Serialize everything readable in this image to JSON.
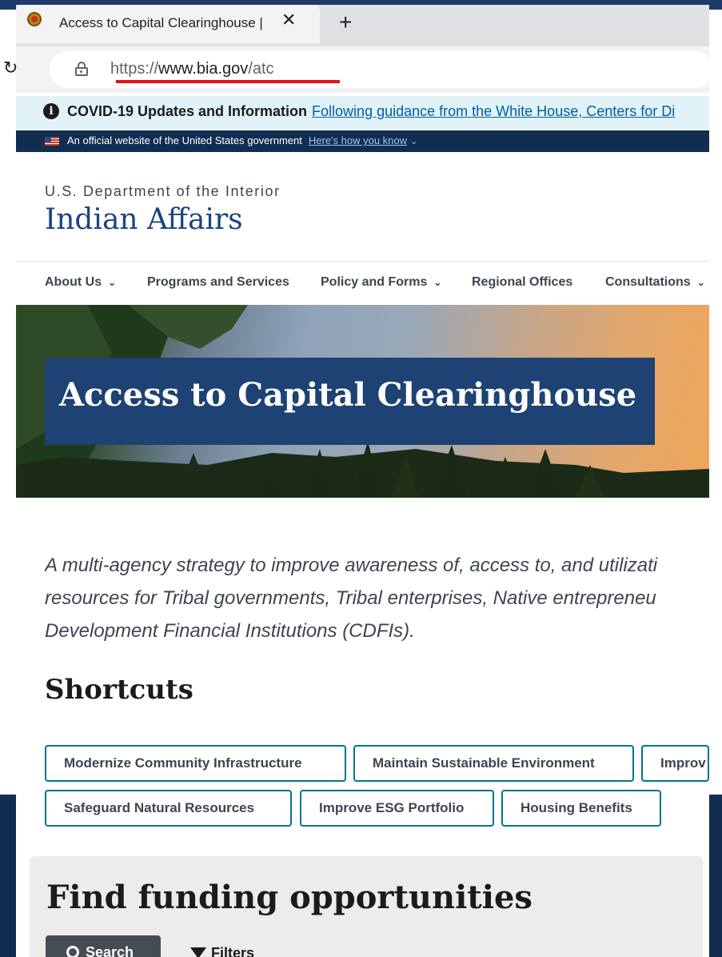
{
  "browser": {
    "tab_title": "Access to Capital Clearinghouse |",
    "url_scheme": "https://",
    "url_host": "www.bia.gov",
    "url_path": "/atc"
  },
  "covid_banner": {
    "heading": "COVID-19 Updates and Information",
    "link": "Following guidance from the White House, Centers for Di"
  },
  "gov_banner": {
    "text": "An official website of the United States government",
    "link": "Here's how you know"
  },
  "site": {
    "agency": "U.S. Department of the Interior",
    "title": "Indian Affairs"
  },
  "nav": [
    {
      "label": "About Us",
      "has_dropdown": true
    },
    {
      "label": "Programs and Services",
      "has_dropdown": false
    },
    {
      "label": "Policy and Forms",
      "has_dropdown": true
    },
    {
      "label": "Regional Offices",
      "has_dropdown": false
    },
    {
      "label": "Consultations",
      "has_dropdown": true
    }
  ],
  "hero": {
    "title": "Access to Capital Clearinghouse"
  },
  "intro": {
    "line1": "A multi-agency strategy to improve awareness of, access to, and utilizati",
    "line2": "resources for Tribal governments, Tribal enterprises, Native entrepreneu",
    "line3": "Development Financial Institutions (CDFIs)."
  },
  "shortcuts": {
    "heading": "Shortcuts",
    "items": [
      "Modernize Community Infrastructure",
      "Maintain Sustainable Environment",
      "Improv",
      "Safeguard Natural Resources",
      "Improve ESG Portfolio",
      "Housing Benefits"
    ]
  },
  "funding": {
    "title": "Find funding opportunities",
    "search_label": "Search",
    "filters_label": "Filters"
  },
  "colors": {
    "accent": "#1a4480",
    "gov_banner": "#112e51",
    "shortcut_border": "#00738e",
    "url_highlight": "#e8101b"
  }
}
